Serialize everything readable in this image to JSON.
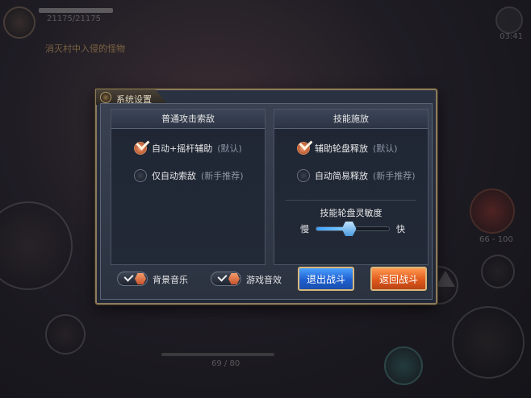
{
  "hud": {
    "player_id": "21175/21175",
    "chat_line": "消灭村中入侵的怪物",
    "time": "03:41",
    "counter_right": "66 - 100",
    "counter_bottom": "69 / 80"
  },
  "dialog": {
    "title": "系统设置",
    "attack_section": {
      "header": "普通攻击索敌",
      "options": [
        {
          "label": "自动+摇杆辅助",
          "hint": "(默认)",
          "selected": true
        },
        {
          "label": "仅自动索敌",
          "hint": "(新手推荐)",
          "selected": false
        }
      ]
    },
    "skill_section": {
      "header": "技能施放",
      "options": [
        {
          "label": "辅助轮盘释放",
          "hint": "(默认)",
          "selected": true
        },
        {
          "label": "自动简易释放",
          "hint": "(新手推荐)",
          "selected": false
        }
      ],
      "sensitivity": {
        "title": "技能轮盘灵敏度",
        "min_label": "慢",
        "max_label": "快",
        "value": 0.45
      }
    },
    "toggles": [
      {
        "label": "背景音乐",
        "on": true
      },
      {
        "label": "游戏音效",
        "on": true
      }
    ],
    "buttons": {
      "exit": "退出战斗",
      "back": "返回战斗"
    }
  }
}
